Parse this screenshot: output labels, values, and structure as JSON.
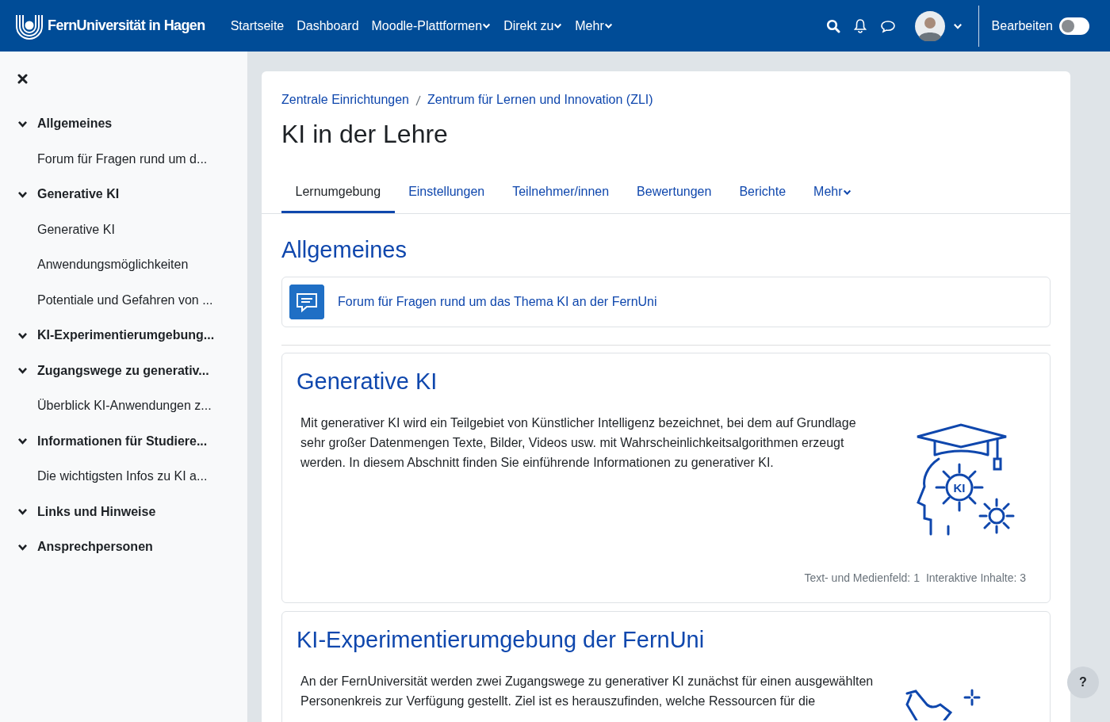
{
  "navbar": {
    "brand": "FernUniversität in Hagen",
    "links": [
      {
        "label": "Startseite",
        "dropdown": false
      },
      {
        "label": "Dashboard",
        "dropdown": false
      },
      {
        "label": "Moodle-Plattformen",
        "dropdown": true
      },
      {
        "label": "Direkt zu",
        "dropdown": true
      },
      {
        "label": "Mehr",
        "dropdown": true
      }
    ],
    "edit_mode": {
      "label": "Bearbeiten",
      "on": false
    }
  },
  "sidebar": {
    "items": [
      {
        "kind": "section",
        "label": "Allgemeines",
        "expanded": true
      },
      {
        "kind": "activity",
        "label": "Forum für Fragen rund um d..."
      },
      {
        "kind": "section",
        "label": "Generative KI",
        "expanded": true
      },
      {
        "kind": "activity",
        "label": "Generative KI"
      },
      {
        "kind": "activity",
        "label": "Anwendungsmöglichkeiten"
      },
      {
        "kind": "activity",
        "label": "Potentiale und Gefahren von ..."
      },
      {
        "kind": "section",
        "label": "KI-Experimentierumgebung...",
        "expanded": true
      },
      {
        "kind": "section",
        "label": "Zugangswege zu generativ...",
        "expanded": true
      },
      {
        "kind": "activity",
        "label": "Überblick KI-Anwendungen z..."
      },
      {
        "kind": "section",
        "label": "Informationen für Studiere...",
        "expanded": true
      },
      {
        "kind": "activity",
        "label": "Die wichtigsten Infos zu KI a..."
      },
      {
        "kind": "section",
        "label": "Links und Hinweise",
        "expanded": true
      },
      {
        "kind": "section",
        "label": "Ansprechpersonen",
        "expanded": true
      }
    ]
  },
  "breadcrumb": [
    "Zentrale Einrichtungen",
    "Zentrum für Lernen und Innovation (ZLI)"
  ],
  "page_title": "KI in der Lehre",
  "tabs": [
    {
      "label": "Lernumgebung",
      "selected": true,
      "dropdown": false
    },
    {
      "label": "Einstellungen",
      "selected": false,
      "dropdown": false
    },
    {
      "label": "Teilnehmer/innen",
      "selected": false,
      "dropdown": false
    },
    {
      "label": "Bewertungen",
      "selected": false,
      "dropdown": false
    },
    {
      "label": "Berichte",
      "selected": false,
      "dropdown": false
    },
    {
      "label": "Mehr",
      "selected": false,
      "dropdown": true
    }
  ],
  "general": {
    "title": "Allgemeines",
    "activities": [
      {
        "kind": "forum",
        "label": "Forum für Fragen rund um das Thema KI an der FernUni"
      }
    ]
  },
  "sections": [
    {
      "title": "Generative KI",
      "summary": "Mit generativer KI wird ein Teilgebiet von Künstlicher Intelligenz bezeichnet, bei dem auf Grundlage sehr großer Datenmengen Texte, Bilder, Videos usw. mit Wahrscheinlichkeitsalgorithmen erzeugt werden. In diesem Abschnitt finden Sie einführende Informationen zu generativer KI.",
      "illustration": {
        "kind": "head",
        "text": "KI"
      },
      "counts": [
        "Text- und Medienfeld: 1",
        "Interaktive Inhalte: 3"
      ]
    },
    {
      "title": "KI-Experimentierumgebung der FernUni",
      "summary": "An der FernUniversität werden zwei Zugangswege zu generativer KI zunächst für einen ausgewählten Personenkreis zur Verfügung gestellt. Ziel ist es herauszufinden, welche Ressourcen für die",
      "illustration": {
        "kind": "sparkle"
      }
    }
  ],
  "help_button": "?"
}
